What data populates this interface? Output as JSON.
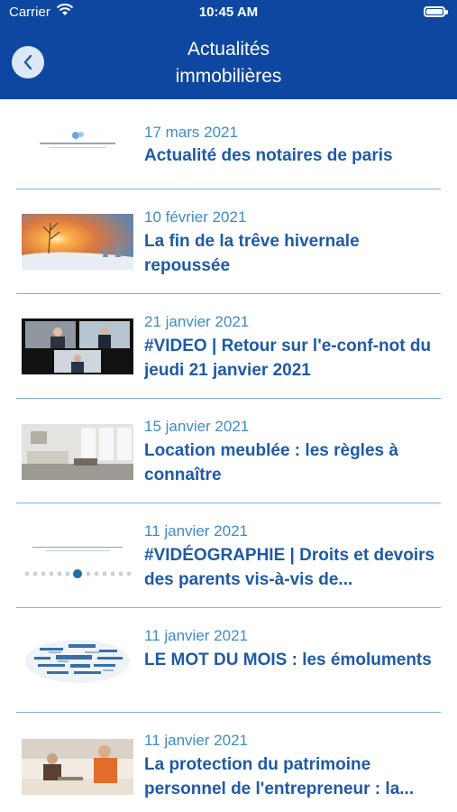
{
  "status_bar": {
    "carrier": "Carrier",
    "time": "10:45 AM"
  },
  "header": {
    "title_line1": "Actualités",
    "title_line2": "immobilières"
  },
  "articles": [
    {
      "date": "17 mars 2021",
      "title": "Actualité des notaires de paris",
      "thumb": "logo-notaires"
    },
    {
      "date": "10 février 2021",
      "title": "La fin de la trêve hivernale repoussée",
      "thumb": "sunrise-snow"
    },
    {
      "date": "21 janvier 2021",
      "title": "#VIDEO | Retour sur l'e-conf-not du jeudi 21 janvier 2021",
      "thumb": "video-conference"
    },
    {
      "date": "15 janvier 2021",
      "title": "Location meublée : les règles à connaître",
      "thumb": "living-room"
    },
    {
      "date": "11 janvier 2021",
      "title": "#VIDÉOGRAPHIE | Droits et devoirs des parents vis-à-vis de...",
      "thumb": "slides-dots"
    },
    {
      "date": "11 janvier 2021",
      "title": "LE MOT DU MOIS : les émoluments",
      "thumb": "word-cloud"
    },
    {
      "date": "11 janvier 2021",
      "title": "La protection du patrimoine personnel de l'entrepreneur : la...",
      "thumb": "office-people"
    }
  ],
  "colors": {
    "header_bg": "#0d47a1",
    "date": "#3f8bc9",
    "title": "#1f5aa6",
    "divider": "#7fb0dc"
  }
}
